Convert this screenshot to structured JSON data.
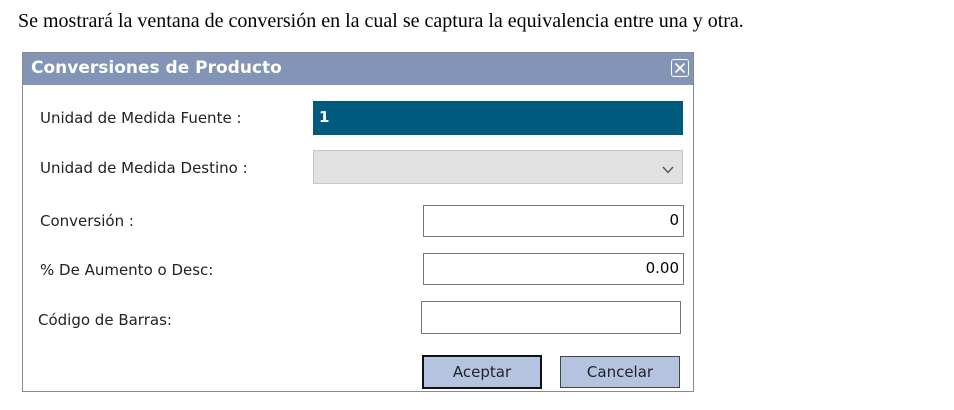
{
  "intro_text": "Se mostrará la ventana de conversión en la cual se captura la equivalencia entre una y otra.",
  "dialog": {
    "title": "Conversiones de Producto",
    "close_icon": "close-icon",
    "fields": {
      "source_unit": {
        "label": "Unidad de Medida Fuente :",
        "value": "1"
      },
      "target_unit": {
        "label": "Unidad de Medida Destino :",
        "value": "",
        "icon": "chevron-down-icon"
      },
      "conversion": {
        "label": "Conversión :",
        "value": "0"
      },
      "percent": {
        "label": "% De Aumento o Desc:",
        "value": "0.00"
      },
      "barcode": {
        "label": "Código de Barras:",
        "value": ""
      }
    },
    "buttons": {
      "accept": "Aceptar",
      "cancel": "Cancelar"
    }
  },
  "colors": {
    "titlebar": "#8295b6",
    "source_field_bg": "#005a7e",
    "button_bg": "#b4c4e0",
    "select_bg": "#e1e1e1"
  }
}
